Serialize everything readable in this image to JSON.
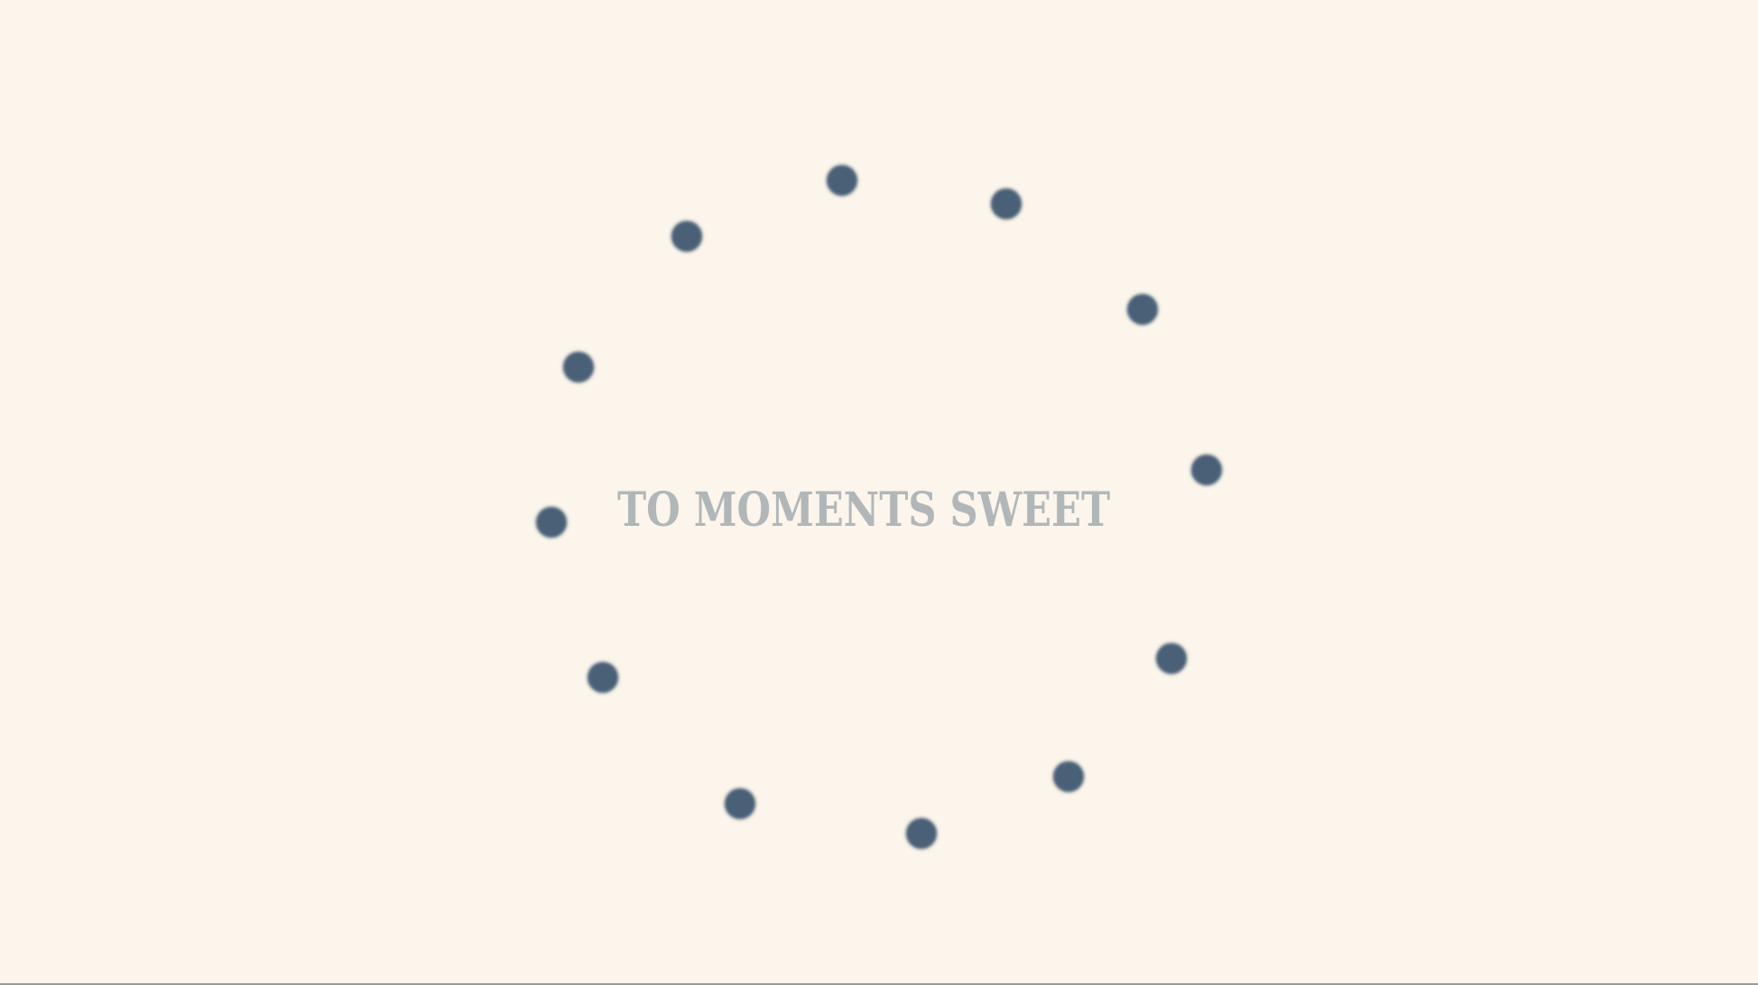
{
  "headline": {
    "text": "TO MOMENTS SWEET"
  },
  "colors": {
    "background": "#fbf5eb",
    "dot": "#4a6077",
    "headline": "#b1b7b9"
  },
  "loading_indicator": {
    "dot_count": 12,
    "icon": "dot-circle"
  }
}
